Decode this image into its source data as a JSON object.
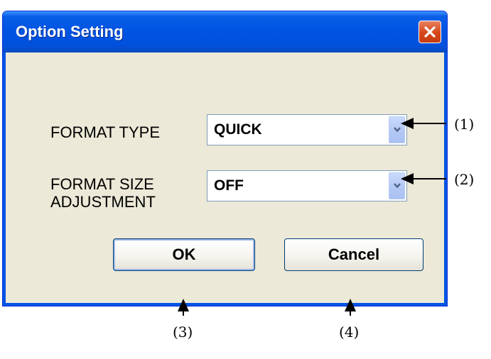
{
  "dialog": {
    "title": "Option Setting",
    "format_type": {
      "label": "FORMAT TYPE",
      "value": "QUICK"
    },
    "format_size_adjustment": {
      "label_line1": "FORMAT SIZE",
      "label_line2": "ADJUSTMENT",
      "value": "OFF"
    },
    "ok_label": "OK",
    "cancel_label": "Cancel"
  },
  "callouts": {
    "c1": "(1)",
    "c2": "(2)",
    "c3": "(3)",
    "c4": "(4)"
  },
  "icons": {
    "close": "close-icon",
    "dropdown": "chevron-down-icon"
  },
  "colors": {
    "titlebar": "#0054e3",
    "close_button": "#d6471a",
    "dialog_face": "#ece9d8"
  }
}
